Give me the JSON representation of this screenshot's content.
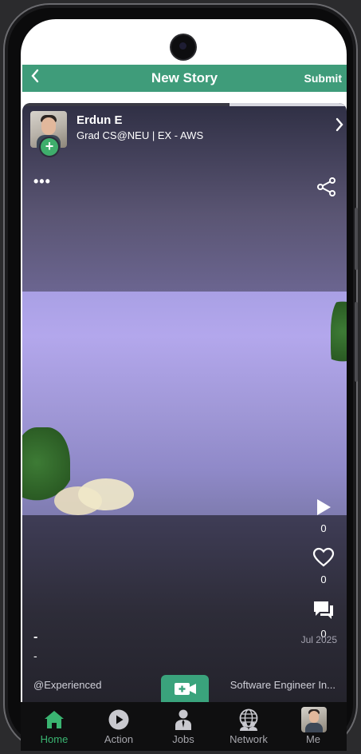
{
  "header": {
    "back_icon": "chevron-left-icon",
    "title": "New Story",
    "submit_label": "Submit"
  },
  "story": {
    "progress_fraction": 0.36,
    "author_name": "Erdun E",
    "author_subtitle": "Grad CS@NEU  | EX - AWS",
    "more_label": "•••",
    "play_count": "0",
    "like_count": "0",
    "comment_count": "0",
    "caption_line1": "-",
    "caption_line2": "-",
    "date": "Jul 2025",
    "tag_left": "@Experienced",
    "tag_right": "Software Engineer In..."
  },
  "tabs": [
    {
      "label": "Home",
      "icon": "home-icon",
      "active": true
    },
    {
      "label": "Action",
      "icon": "play-circle-icon",
      "active": false
    },
    {
      "label": "Jobs",
      "icon": "person-tie-icon",
      "active": false
    },
    {
      "label": "Network",
      "icon": "globe-people-icon",
      "active": false
    },
    {
      "label": "Me",
      "icon": "avatar",
      "active": false
    }
  ],
  "colors": {
    "accent": "#3f9c7a",
    "active_tab": "#3ab471",
    "tab_inactive": "#a7a7ad"
  }
}
